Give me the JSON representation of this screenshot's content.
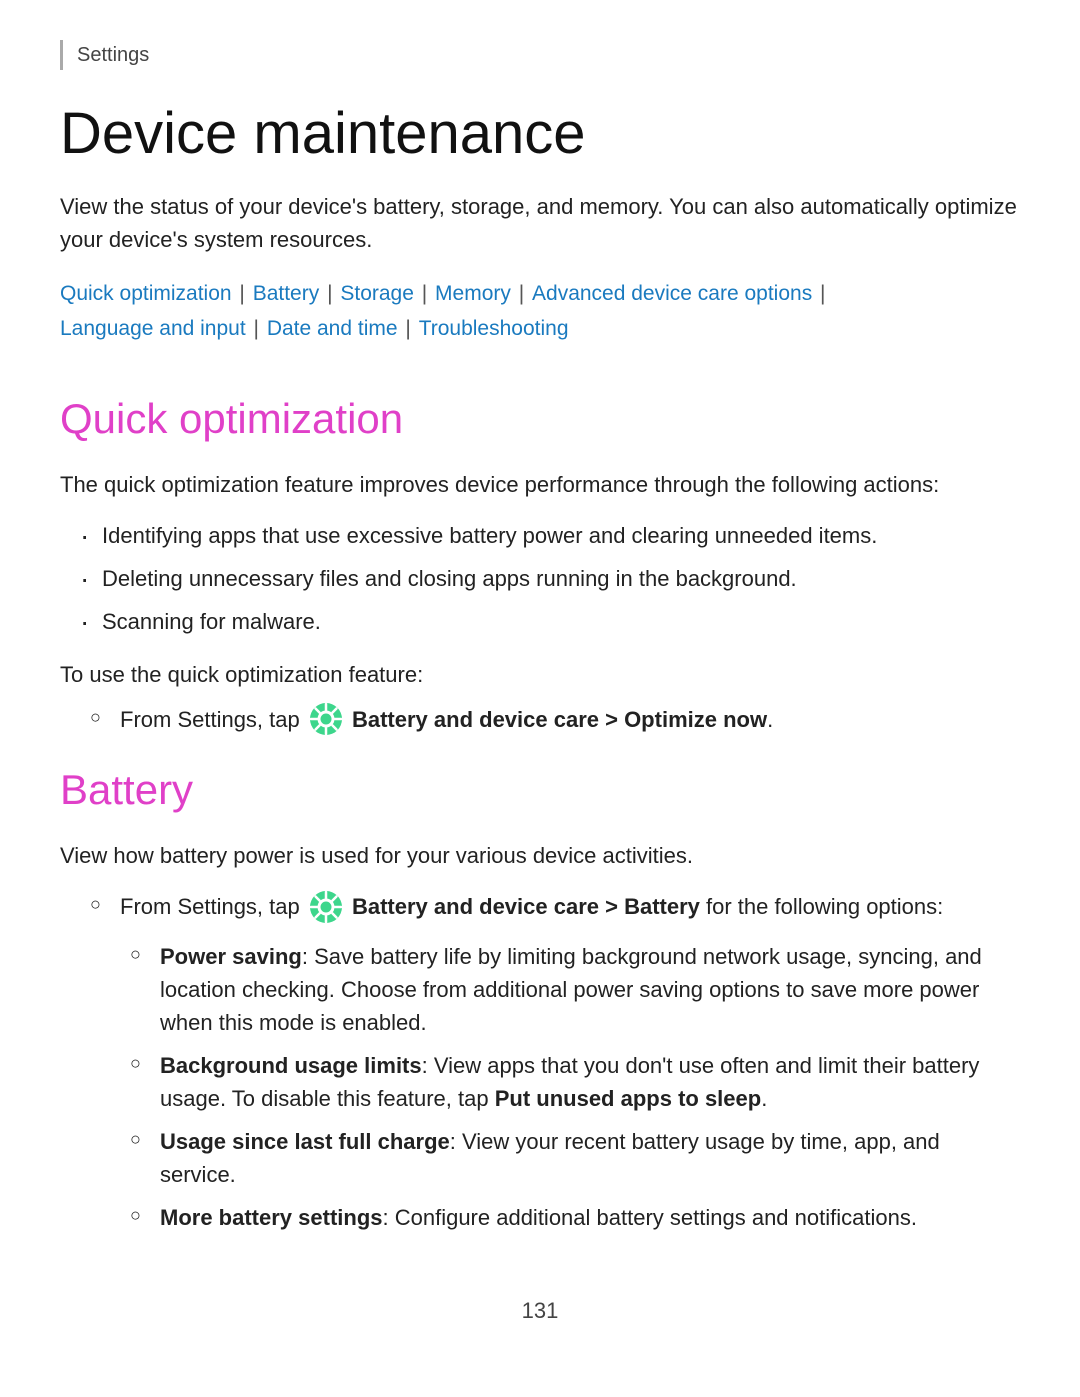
{
  "header": {
    "settings_label": "Settings"
  },
  "page": {
    "title": "Device maintenance",
    "intro": "View the status of your device's battery, storage, and memory. You can also automatically optimize your device's system resources.",
    "nav_links": [
      {
        "label": "Quick optimization",
        "href": "#quick-optimization"
      },
      {
        "label": "Battery",
        "href": "#battery"
      },
      {
        "label": "Storage",
        "href": "#storage"
      },
      {
        "label": "Memory",
        "href": "#memory"
      },
      {
        "label": "Advanced device care options",
        "href": "#advanced"
      },
      {
        "label": "Language and input",
        "href": "#language"
      },
      {
        "label": "Date and time",
        "href": "#date"
      },
      {
        "label": "Troubleshooting",
        "href": "#troubleshooting"
      }
    ]
  },
  "sections": {
    "quick_optimization": {
      "heading": "Quick optimization",
      "intro": "The quick optimization feature improves device performance through the following actions:",
      "bullets": [
        "Identifying apps that use excessive battery power and clearing unneeded items.",
        "Deleting unnecessary files and closing apps running in the background.",
        "Scanning for malware."
      ],
      "step_intro": "To use the quick optimization feature:",
      "step": "From Settings, tap  Battery and device care > Optimize now."
    },
    "battery": {
      "heading": "Battery",
      "intro": "View how battery power is used for your various device activities.",
      "step": "From Settings, tap  Battery and device care > Battery for the following options:",
      "options": [
        {
          "label": "Power saving",
          "desc": ": Save battery life by limiting background network usage, syncing, and location checking. Choose from additional power saving options to save more power when this mode is enabled."
        },
        {
          "label": "Background usage limits",
          "desc": ": View apps that you don't use often and limit their battery usage. To disable this feature, tap Put unused apps to sleep."
        },
        {
          "label": "Usage since last full charge",
          "desc": ": View your recent battery usage by time, app, and service."
        },
        {
          "label": "More battery settings",
          "desc": ": Configure additional battery settings and notifications."
        }
      ]
    }
  },
  "footer": {
    "page_number": "131"
  }
}
